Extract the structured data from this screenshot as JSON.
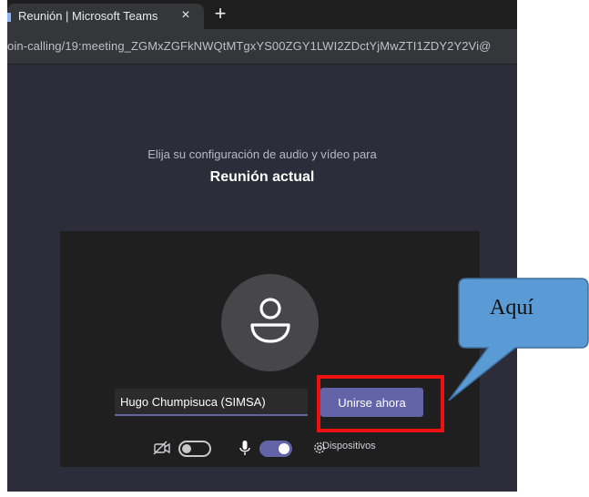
{
  "browser": {
    "tab_title": "Reunión | Microsoft Teams",
    "tab_close": "×",
    "new_tab": "+",
    "url": "oin-calling/19:meeting_ZGMxZGFkNWQtMTgxYS00ZGY1LWI2ZDctYjMwZTI1ZDY2Y2Vi@"
  },
  "prejoin": {
    "subtitle": "Elija su configuración de audio y vídeo para",
    "title": "Reunión actual",
    "name_value": "Hugo Chumpisuca (SIMSA)",
    "join_label": "Unirse ahora",
    "devices_label": "Dispositivos",
    "camera_on": false,
    "mic_on": true
  },
  "annotation": {
    "callout_label": "Aquí",
    "highlight_color": "#ee1111",
    "callout_fill": "#5b9bd5"
  },
  "colors": {
    "accent": "#6264a7",
    "background": "#2d2c3a",
    "panel": "#1f1f1f"
  },
  "icons": [
    "video-off-icon",
    "microphone-icon",
    "gear-icon",
    "user-icon"
  ]
}
